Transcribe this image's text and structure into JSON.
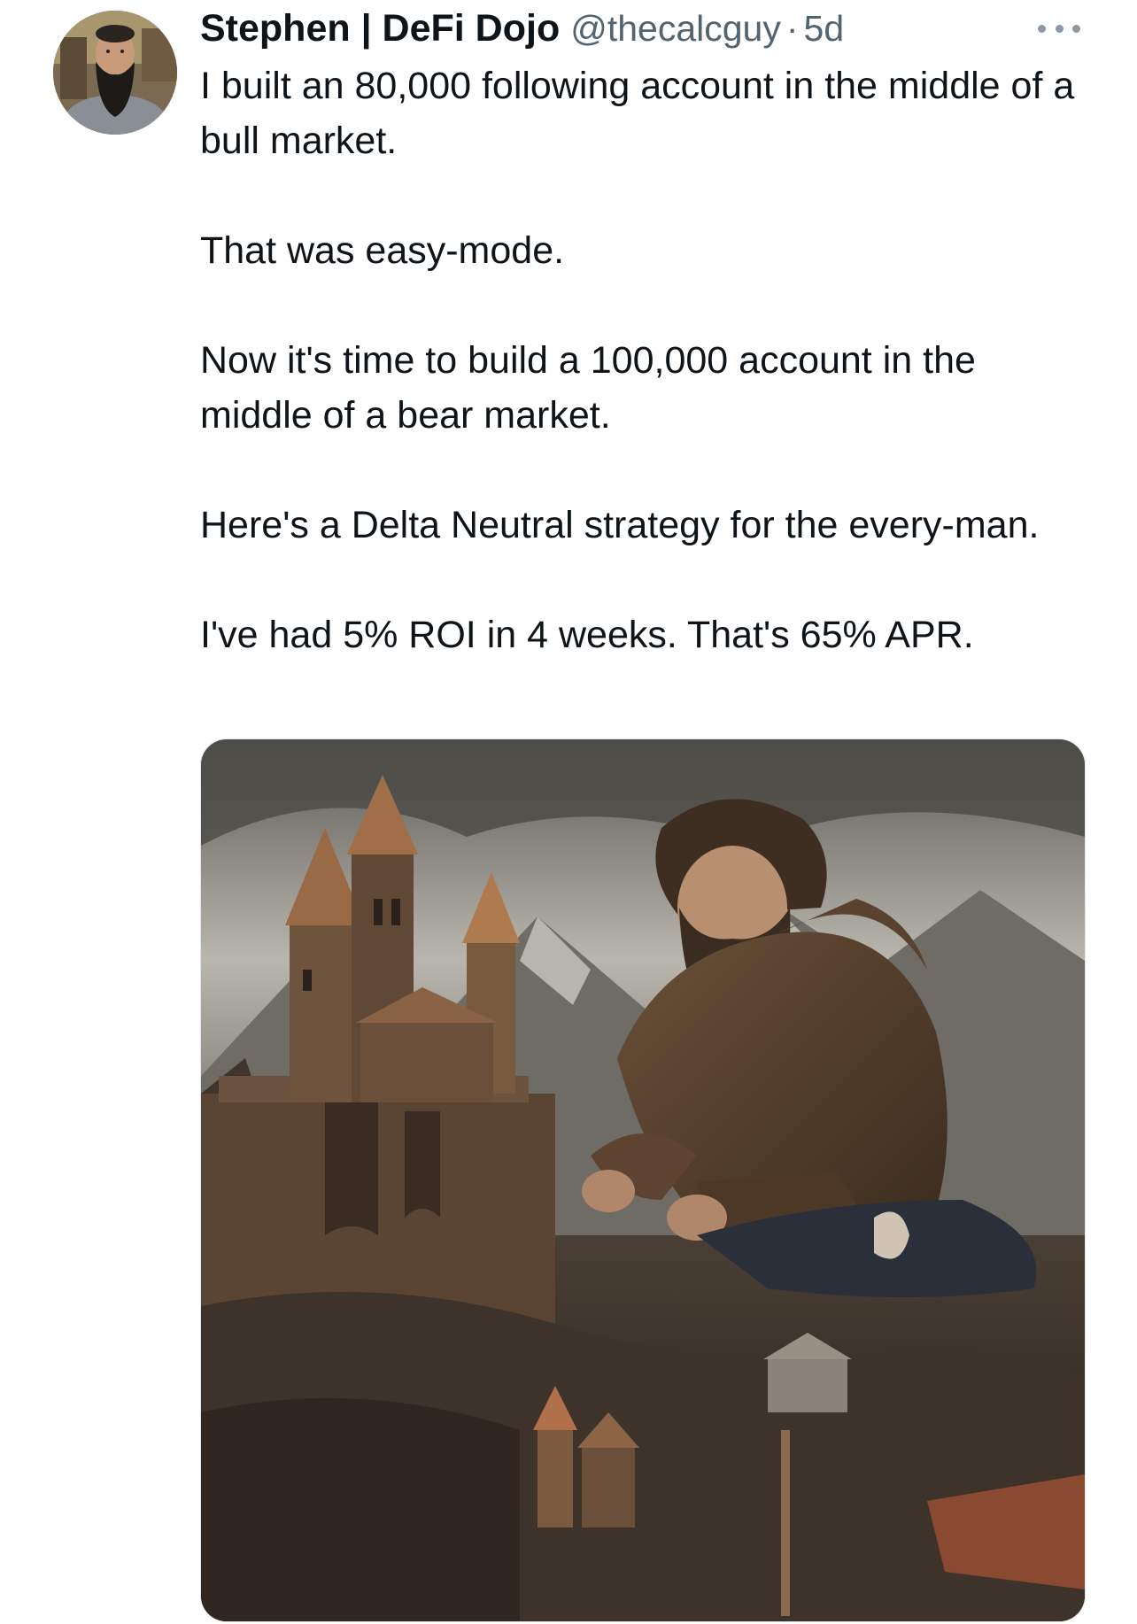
{
  "tweet": {
    "author": {
      "display_name": "Stephen | DeFi Dojo",
      "handle": "@thecalcguy",
      "separator": "·",
      "time": "5d"
    },
    "more_icon": "more-horizontal-icon",
    "paragraphs": [
      "I built an 80,000 following account in the middle of a bull market.",
      "That was easy-mode.",
      "Now it's time to build a 100,000 account in the middle of a bear market.",
      "Here's a Delta Neutral strategy for the every-man.",
      "I've had 5% ROI in 4 weeks. That's 65% APR."
    ]
  }
}
